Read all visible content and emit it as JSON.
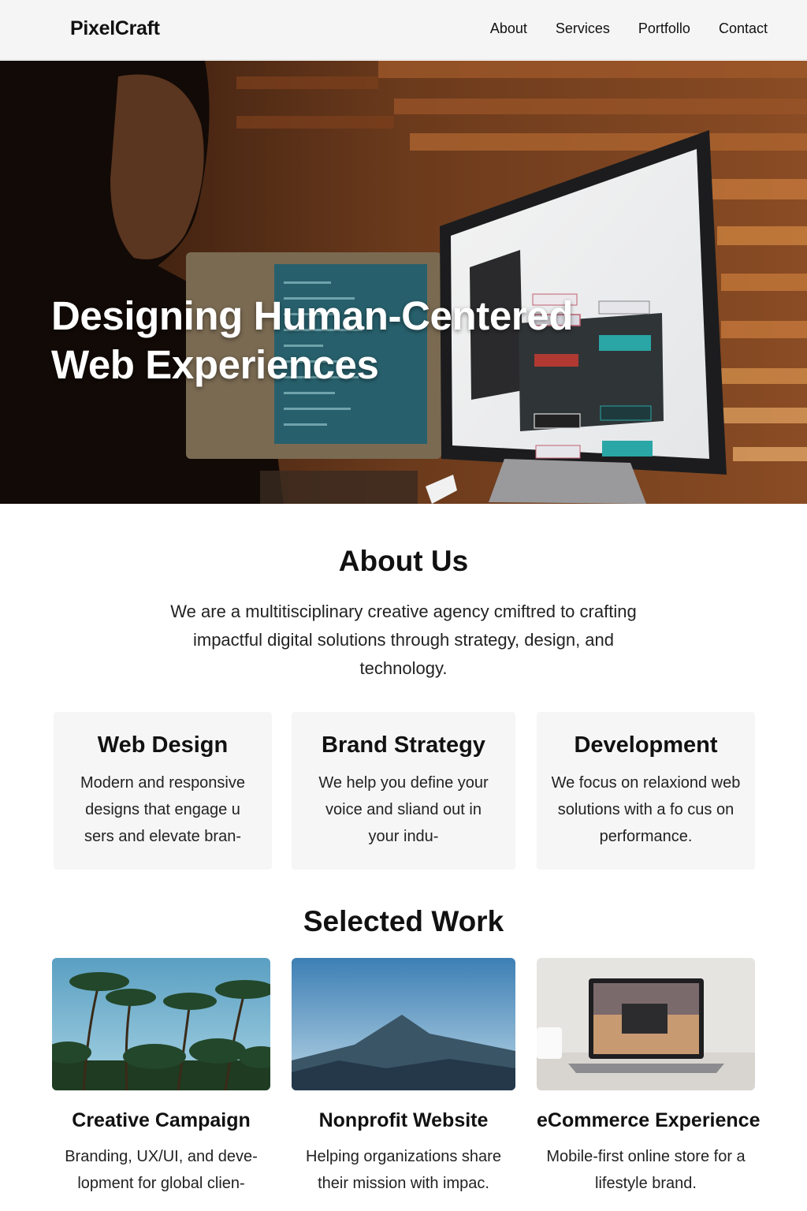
{
  "nav": {
    "brand": "PixelCraft",
    "links": [
      "About",
      "Services",
      "Portfollo",
      "Contact"
    ]
  },
  "hero": {
    "title_line1": "Designing Human-Centered",
    "title_line2": "Web Experiences"
  },
  "about": {
    "title": "About Us",
    "text": "We are a multitisciplinary creative agency cmiftred to crafting impactful digital solutions through strategy, design, and technology."
  },
  "services": [
    {
      "title": "Web Design",
      "text": "Modern and responsive designs that engage u sers and elevate bran-"
    },
    {
      "title": "Brand Strategy",
      "text": "We help you define your voice and sliand out in your indu-"
    },
    {
      "title": "Development",
      "text": "We focus on relaxiond web solutions with a fo cus on performance."
    }
  ],
  "work": {
    "title": "Selected Work",
    "items": [
      {
        "title": "Creative Campaign",
        "text": "Branding, UX/UI, and deve- lopment for global clien-"
      },
      {
        "title": "Nonprofit Website",
        "text": "Helping organizations share their mission with impac."
      },
      {
        "title": "eCommerce Experience",
        "text": "Mobile-first online store for a lifestyle brand."
      }
    ]
  }
}
